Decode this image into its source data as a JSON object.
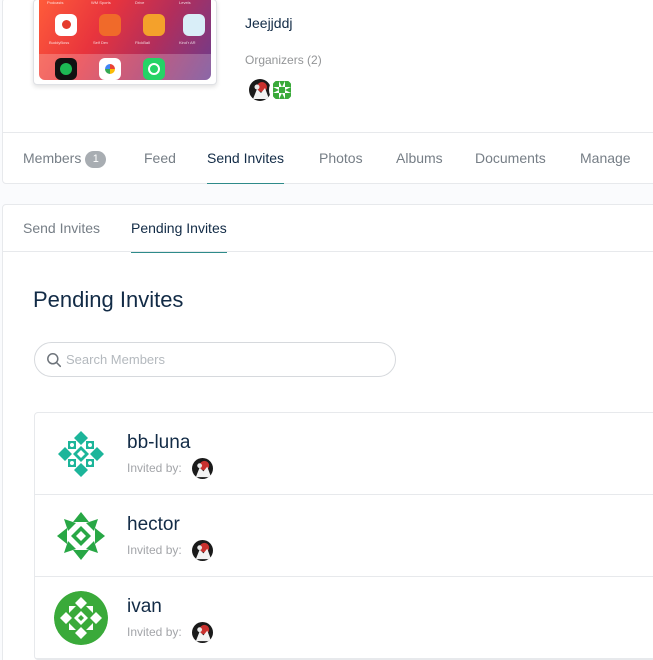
{
  "group": {
    "name": "Jeejjddj",
    "organizers_label": "Organizers (2)"
  },
  "nav": {
    "members": {
      "label": "Members",
      "count": "1"
    },
    "items": [
      "Feed",
      "Send Invites",
      "Photos",
      "Albums",
      "Documents",
      "Manage"
    ],
    "active": "Send Invites"
  },
  "sub_nav": {
    "items": [
      "Send Invites",
      "Pending Invites"
    ],
    "active": "Pending Invites"
  },
  "panel": {
    "title": "Pending Invites",
    "search_placeholder": "Search Members"
  },
  "invites": [
    {
      "name": "bb-luna",
      "invited_by_label": "Invited by:"
    },
    {
      "name": "hector",
      "invited_by_label": "Invited by:"
    },
    {
      "name": "ivan",
      "invited_by_label": "Invited by:"
    }
  ],
  "colors": {
    "accent": "#2e8b8a",
    "text": "#122b46",
    "muted": "#767e86",
    "avatar_teal": "#1cb59a",
    "avatar_green": "#3aaa3a"
  },
  "icons": {
    "search": "search-icon",
    "avatar": "identicon-avatar"
  }
}
